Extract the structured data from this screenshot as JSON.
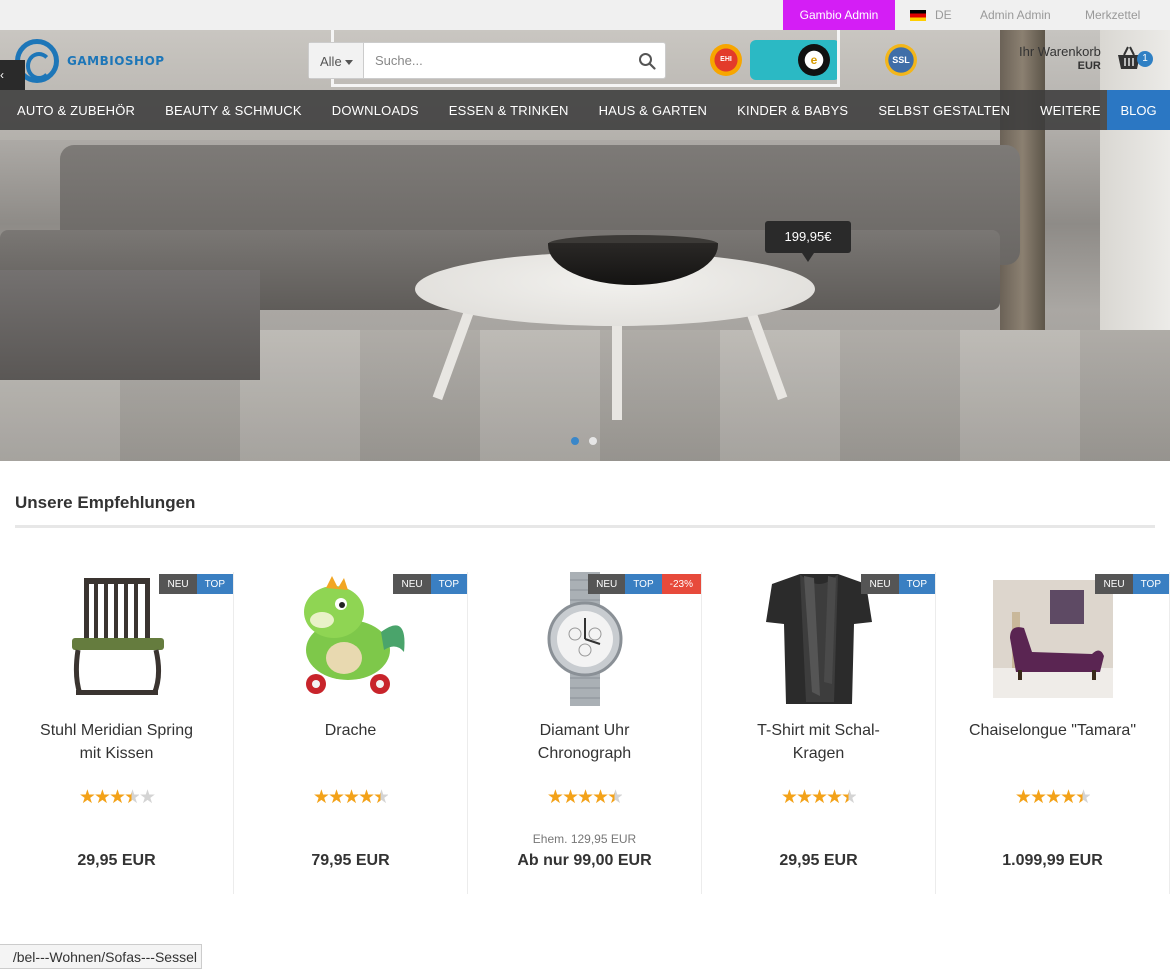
{
  "topbar": {
    "admin_label": "Gambio Admin",
    "language": "DE",
    "user_label": "Admin Admin",
    "wishlist_label": "Merkzettel"
  },
  "header": {
    "logo_text": "GAMBIOSHOP",
    "search": {
      "category": "Alle",
      "placeholder": "Suche..."
    },
    "badges": {
      "ehi": "EHI",
      "trusted": "e",
      "ssl": "SSL"
    },
    "cart": {
      "title": "Ihr Warenkorb",
      "amount": "EUR",
      "count": "1"
    }
  },
  "nav": {
    "items": [
      "AUTO & ZUBEHÖR",
      "BEAUTY & SCHMUCK",
      "DOWNLOADS",
      "ESSEN & TRINKEN",
      "HAUS & GARTEN",
      "KINDER & BABYS",
      "SELBST GESTALTEN",
      "WEITERE"
    ],
    "blog": "BLOG"
  },
  "hero": {
    "price_tag": "199,95€",
    "slides": 2,
    "active_slide": 1
  },
  "recommendations": {
    "title": "Unsere Empfehlungen",
    "products": [
      {
        "name": "Stuhl Meridian Spring mit Kissen",
        "rating": 3.5,
        "old_price": "",
        "price": "29,95 EUR",
        "ribbons": [
          "NEU",
          "TOP"
        ],
        "image": "chair"
      },
      {
        "name": "Drache",
        "rating": 4.5,
        "old_price": "",
        "price": "79,95 EUR",
        "ribbons": [
          "NEU",
          "TOP"
        ],
        "image": "dragon"
      },
      {
        "name": "Diamant Uhr Chronograph",
        "rating": 4.5,
        "old_price": "Ehem. 129,95 EUR",
        "price": "Ab nur 99,00 EUR",
        "ribbons": [
          "NEU",
          "TOP",
          "-23%"
        ],
        "image": "watch"
      },
      {
        "name": "T-Shirt mit Schal-Kragen",
        "rating": 4.5,
        "old_price": "",
        "price": "29,95 EUR",
        "ribbons": [
          "NEU",
          "TOP"
        ],
        "image": "tshirt"
      },
      {
        "name": "Chaiselongue \"Tamara\"",
        "rating": 4.5,
        "old_price": "",
        "price": "1.099,99 EUR",
        "ribbons": [
          "NEU",
          "TOP"
        ],
        "image": "chaise"
      }
    ]
  },
  "statusbar": {
    "url": "bel---Wohnen/Sofas---Sessel/"
  },
  "colors": {
    "admin": "#d41ef5",
    "accent": "#2b77c3",
    "star": "#f3a219",
    "sale": "#e74a3b"
  }
}
